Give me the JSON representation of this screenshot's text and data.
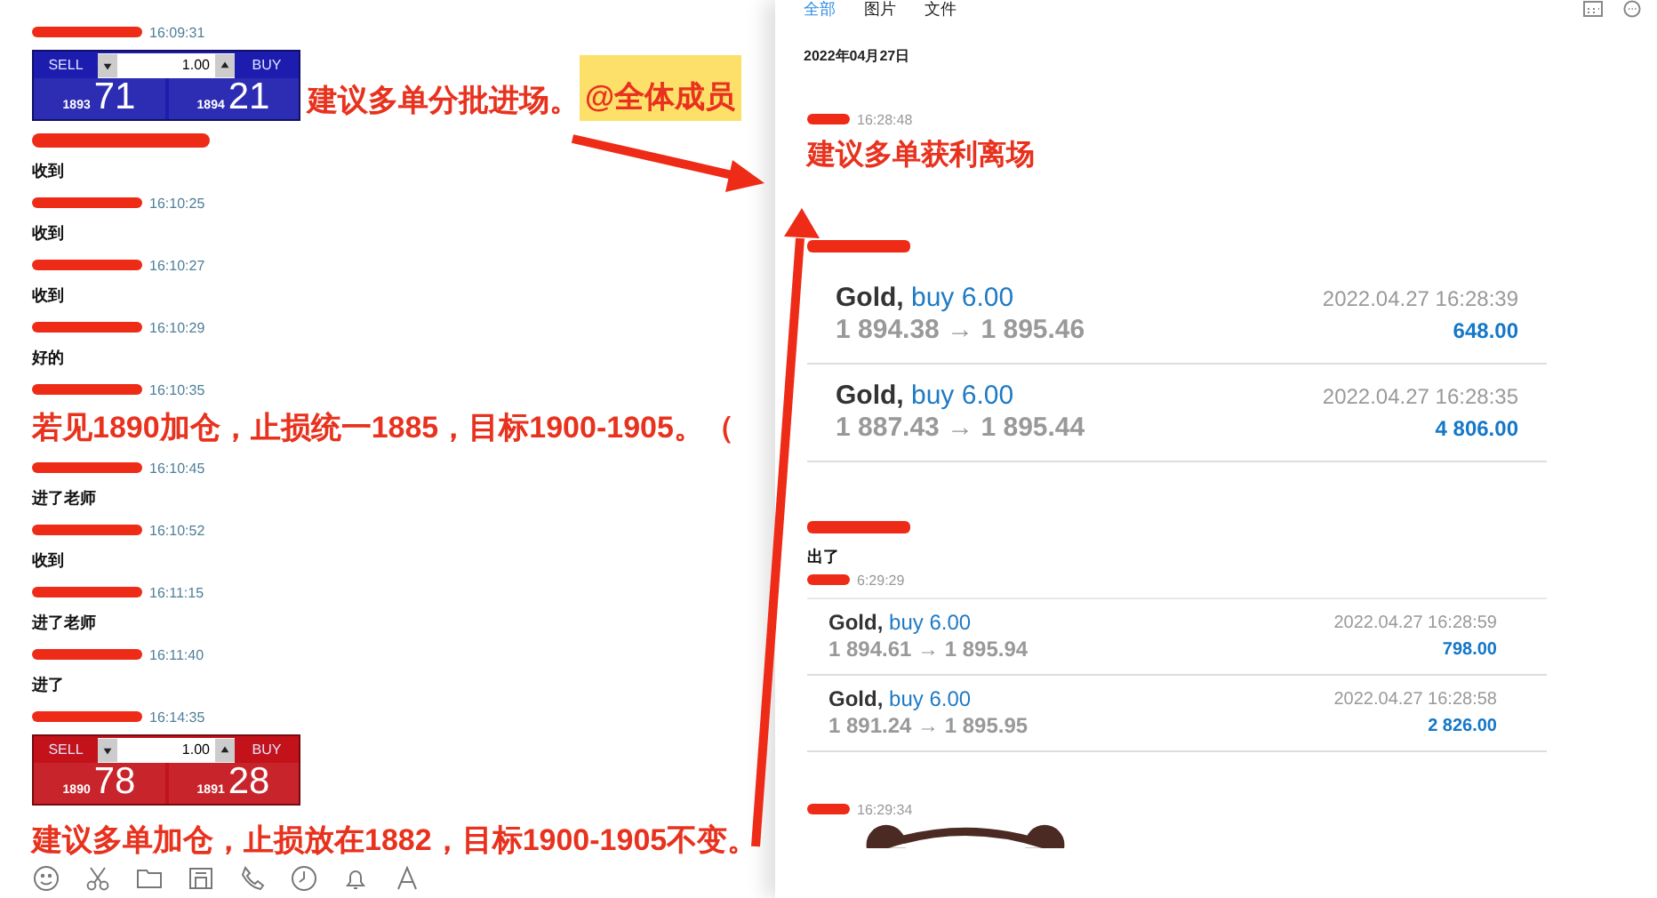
{
  "left_chat": {
    "messages": [
      {
        "time": "16:09:31",
        "kind": "trade_widget",
        "widget": {
          "color": "#1c1cae",
          "sell_label": "SELL",
          "buy_label": "BUY",
          "volume": "1.00",
          "sell_prefix": "1893",
          "sell_big": "71",
          "buy_prefix": "1894",
          "buy_big": "21"
        },
        "caption": "建议多单分批进场。",
        "mention": "@全体成员"
      },
      {
        "kind": "text",
        "text": "收到"
      },
      {
        "time": "16:10:25",
        "kind": "text",
        "text": "收到"
      },
      {
        "time": "16:10:27",
        "kind": "text",
        "text": "收到"
      },
      {
        "time": "16:10:29",
        "kind": "text",
        "text": "好的"
      },
      {
        "time": "16:10:35",
        "kind": "announcement",
        "text": "若见1890加仓，止损统一1885，目标1900-1905。（"
      },
      {
        "time": "16:10:45",
        "kind": "text",
        "text": "进了老师"
      },
      {
        "time": "16:10:52",
        "kind": "text",
        "text": "收到"
      },
      {
        "time": "16:11:15",
        "kind": "text",
        "text": "进了老师"
      },
      {
        "time": "16:11:40",
        "kind": "text",
        "text": "进了"
      },
      {
        "time": "16:14:35",
        "kind": "trade_widget",
        "widget": {
          "color": "#c4121a",
          "sell_label": "SELL",
          "buy_label": "BUY",
          "volume": "1.00",
          "sell_prefix": "1890",
          "sell_big": "78",
          "buy_prefix": "1891",
          "buy_big": "28"
        },
        "caption": "建议多单加仓，止损放在1882，目标1900-1905不变。"
      }
    ]
  },
  "right_panel": {
    "tabs": [
      {
        "label": "全部",
        "selected": true
      },
      {
        "label": "图片",
        "selected": false
      },
      {
        "label": "文件",
        "selected": false
      }
    ],
    "date": "2022年04月27日",
    "messages": [
      {
        "time": "16:28:48",
        "kind": "announcement",
        "text": "建议多单获利离场"
      },
      {
        "kind": "trades",
        "trades": [
          {
            "symbol": "Gold,",
            "action": "buy 6.00",
            "prices": "1 894.38 → 1 895.46",
            "datetime": "2022.04.27 16:28:39",
            "profit": "648.00"
          },
          {
            "symbol": "Gold,",
            "action": "buy 6.00",
            "prices": "1 887.43 → 1 895.44",
            "datetime": "2022.04.27 16:28:35",
            "profit": "4 806.00"
          }
        ]
      },
      {
        "kind": "text",
        "text": "出了"
      },
      {
        "time": "6:29:29",
        "kind": "trades_compact",
        "trades": [
          {
            "symbol": "Gold,",
            "action": "buy 6.00",
            "prices": "1 894.61 → 1 895.94",
            "datetime": "2022.04.27 16:28:59",
            "profit": "798.00"
          },
          {
            "symbol": "Gold,",
            "action": "buy 6.00",
            "prices": "1 891.24 → 1 895.95",
            "datetime": "2022.04.27 16:28:58",
            "profit": "2 826.00"
          }
        ]
      },
      {
        "time": "16:29:34",
        "kind": "sticker"
      }
    ]
  }
}
